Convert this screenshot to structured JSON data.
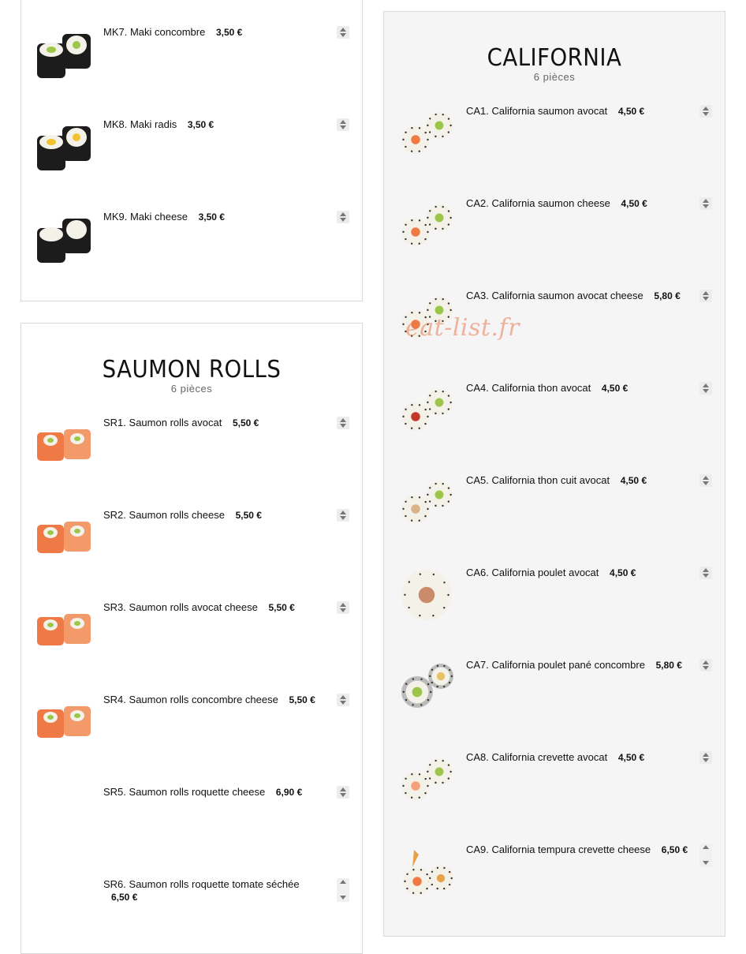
{
  "sections": {
    "maki": {
      "items": [
        {
          "code": "MK7.",
          "name": "Maki concombre",
          "price": "3,50 €",
          "thumb": "maki-cucumber"
        },
        {
          "code": "MK8.",
          "name": "Maki radis",
          "price": "3,50 €",
          "thumb": "maki-radish"
        },
        {
          "code": "MK9.",
          "name": "Maki cheese",
          "price": "3,50 €",
          "thumb": "maki-cheese"
        }
      ]
    },
    "saumon_rolls": {
      "title": "SAUMON ROLLS",
      "subtitle": "6 pièces",
      "items": [
        {
          "code": "SR1.",
          "name": "Saumon rolls avocat",
          "price": "5,50 €",
          "thumb": "salmon-roll"
        },
        {
          "code": "SR2.",
          "name": "Saumon rolls cheese",
          "price": "5,50 €",
          "thumb": "salmon-roll"
        },
        {
          "code": "SR3.",
          "name": "Saumon rolls avocat cheese",
          "price": "5,50 €",
          "thumb": "salmon-roll"
        },
        {
          "code": "SR4.",
          "name": "Saumon rolls concombre cheese",
          "price": "5,50 €",
          "thumb": "salmon-roll"
        },
        {
          "code": "SR5.",
          "name": "Saumon rolls roquette cheese",
          "price": "6,90 €",
          "thumb": ""
        },
        {
          "code": "SR6.",
          "name": "Saumon rolls roquette tomate séchée",
          "price": "6,50 €",
          "thumb": ""
        }
      ]
    },
    "california": {
      "title": "CALIFORNIA",
      "subtitle": "6 pièces",
      "items": [
        {
          "code": "CA1.",
          "name": "California saumon avocat",
          "price": "4,50 €",
          "thumb": "california-roll"
        },
        {
          "code": "CA2.",
          "name": "California saumon cheese",
          "price": "4,50 €",
          "thumb": "california-roll"
        },
        {
          "code": "CA3.",
          "name": "California saumon avocat cheese",
          "price": "5,80 €",
          "thumb": "california-roll"
        },
        {
          "code": "CA4.",
          "name": "California thon avocat",
          "price": "4,50 €",
          "thumb": "california-roll"
        },
        {
          "code": "CA5.",
          "name": "California thon cuit avocat",
          "price": "4,50 €",
          "thumb": "california-roll"
        },
        {
          "code": "CA6.",
          "name": "California poulet avocat",
          "price": "4,50 €",
          "thumb": "california-roll"
        },
        {
          "code": "CA7.",
          "name": "California poulet pané concombre",
          "price": "5,80 €",
          "thumb": "california-roll-sesame"
        },
        {
          "code": "CA8.",
          "name": "California crevette avocat",
          "price": "4,50 €",
          "thumb": "california-roll"
        },
        {
          "code": "CA9.",
          "name": "California tempura crevette cheese",
          "price": "6,50 €",
          "thumb": "california-roll-tempura"
        }
      ]
    }
  },
  "watermark": "eat-list.fr",
  "colors": {
    "nori": "#1c1c1c",
    "rice": "#f4f1e8",
    "salmon": "#f07a45",
    "avocado": "#9bc64a",
    "radish": "#f2c230",
    "panel_alt_bg": "#f5f5f5"
  },
  "icons": {
    "quantity": "up-down-stepper-icon"
  }
}
